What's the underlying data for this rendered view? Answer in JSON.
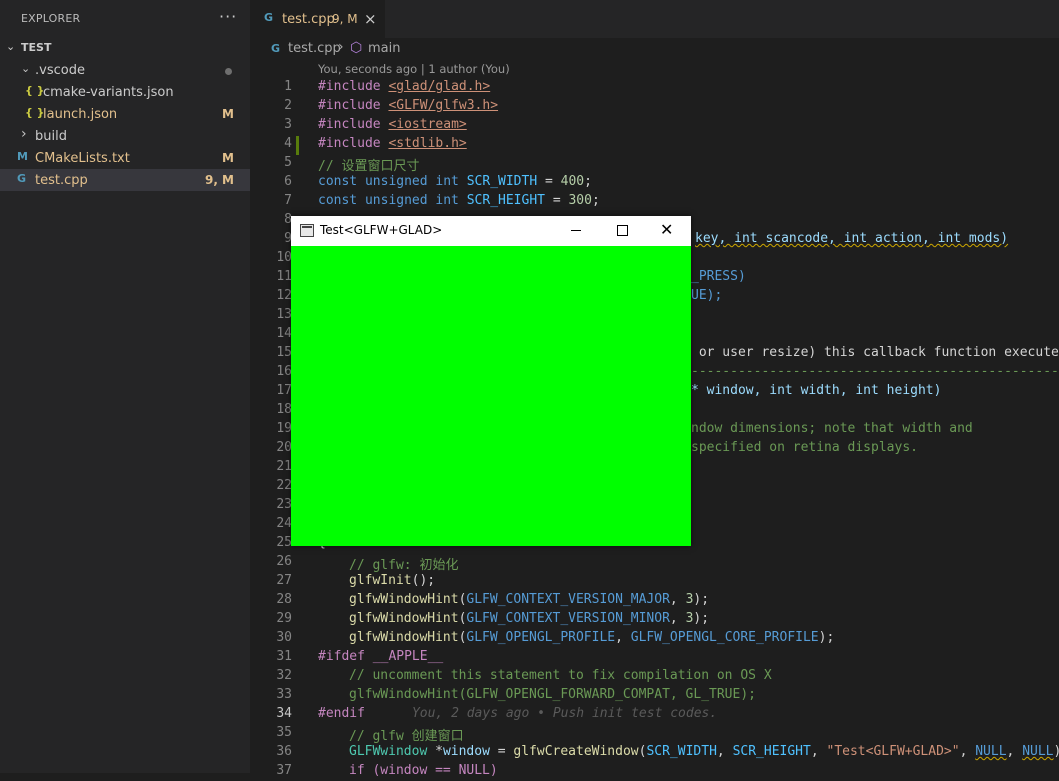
{
  "sidebar": {
    "title": "EXPLORER",
    "more": "···",
    "section": {
      "chevron": "⌄",
      "title": "TEST"
    },
    "items": [
      {
        "chevron": "⌄",
        "label": "vscode",
        "prefix": ".",
        "status": "",
        "has_dot": true
      },
      {
        "icon": "{ }",
        "label": "cmake-variants.json",
        "status": ""
      },
      {
        "icon": "{ }",
        "label": "launch.json",
        "status": "M"
      },
      {
        "chevron": "›",
        "label": "build",
        "status": ""
      },
      {
        "icon": "M",
        "label": "CMakeLists.txt",
        "status": "M"
      },
      {
        "icon": "G",
        "label": "test.cpp",
        "status": "9, M"
      }
    ]
  },
  "tab": {
    "icon": "G",
    "name": "test.cpp",
    "status": "9, M",
    "close": "×"
  },
  "breadcrumb": {
    "file": "test.cpp",
    "sep": "›",
    "symbol": "main"
  },
  "codelens": "You, seconds ago | 1 author (You)",
  "lines": [
    {
      "n": "1"
    },
    {
      "n": "2"
    },
    {
      "n": "3"
    },
    {
      "n": "4"
    },
    {
      "n": "5"
    },
    {
      "n": "6"
    },
    {
      "n": "7"
    },
    {
      "n": "8"
    },
    {
      "n": "9"
    },
    {
      "n": "10"
    },
    {
      "n": "11"
    },
    {
      "n": "12"
    },
    {
      "n": "13"
    },
    {
      "n": "14"
    },
    {
      "n": "15"
    },
    {
      "n": "16"
    },
    {
      "n": "17"
    },
    {
      "n": "18"
    },
    {
      "n": "19"
    },
    {
      "n": "20"
    },
    {
      "n": "21"
    },
    {
      "n": "22"
    },
    {
      "n": "23"
    },
    {
      "n": "24"
    },
    {
      "n": "25"
    },
    {
      "n": "26"
    },
    {
      "n": "27"
    },
    {
      "n": "28"
    },
    {
      "n": "29"
    },
    {
      "n": "30"
    },
    {
      "n": "31"
    },
    {
      "n": "32"
    },
    {
      "n": "33"
    },
    {
      "n": "34"
    },
    {
      "n": "35"
    },
    {
      "n": "36"
    },
    {
      "n": "37"
    }
  ],
  "code": {
    "inc1": "<glad/glad.h>",
    "inc2": "<GLFW/glfw3.h>",
    "inc3": "<iostream>",
    "inc4": "<stdlib.h>",
    "l5": "// 设置窗口尺寸",
    "l6_name": "SCR_WIDTH",
    "l6_val": "400",
    "l7_name": "SCR_HEIGHT",
    "l7_val": "300",
    "l9": "key, int scancode, int action, int mods)",
    "l11": "_PRESS)",
    "l12": "UE);",
    "l15": " or user resize) this callback function executes",
    "l16": "----------------------------------------------------",
    "l17": "* window, int width, int height)",
    "l19": "ndow dimensions; note that width and",
    "l20": "specified on retina displays.",
    "l26": "// glfw: 初始化",
    "l27": "glfwInit",
    "l28_arg": "GLFW_CONTEXT_VERSION_MAJOR",
    "l28_num": "3",
    "l29_arg": "GLFW_CONTEXT_VERSION_MINOR",
    "l29_num": "3",
    "l30_a": "GLFW_OPENGL_PROFILE",
    "l30_b": "GLFW_OPENGL_CORE_PROFILE",
    "l31": "#ifdef __APPLE__",
    "l32": "// uncomment this statement to fix compilation on OS X",
    "l33": "glfwWindowHint(GLFW_OPENGL_FORWARD_COMPAT, GL_TRUE);",
    "l34": "#endif",
    "l34_blame": "You, 2 days ago • Push init test codes.",
    "l35": "// glfw 创建窗口",
    "l36_str": "\"Test<GLFW+GLAD>\"",
    "l37": "if (window == NULL)"
  },
  "glfw_window": {
    "title": "Test<GLFW+GLAD>",
    "minimize": "",
    "maximize": "",
    "close": "✕",
    "canvas_color": "#00ff00"
  }
}
